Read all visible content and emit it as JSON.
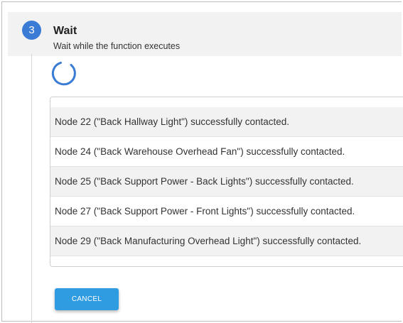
{
  "step": {
    "number": "3",
    "title": "Wait",
    "subtitle": "Wait while the function executes"
  },
  "log": {
    "rows": [
      "Node 22 (\"Back Hallway Light\") successfully contacted.",
      "Node 24 (\"Back Warehouse Overhead Fan\") successfully contacted.",
      "Node 25 (\"Back Support Power - Back Lights\") successfully contacted.",
      "Node 27 (\"Back Support Power - Front Lights\") successfully contacted.",
      "Node 29 (\"Back Manufacturing Overhead Light\") successfully contacted."
    ]
  },
  "actions": {
    "cancel_label": "CANCEL"
  },
  "colors": {
    "step_circle": "#3a7bd5",
    "spinner": "#3a7bd5",
    "cancel_button": "#2f9be0"
  },
  "icons": {
    "spinner": "loading-spinner-icon"
  }
}
